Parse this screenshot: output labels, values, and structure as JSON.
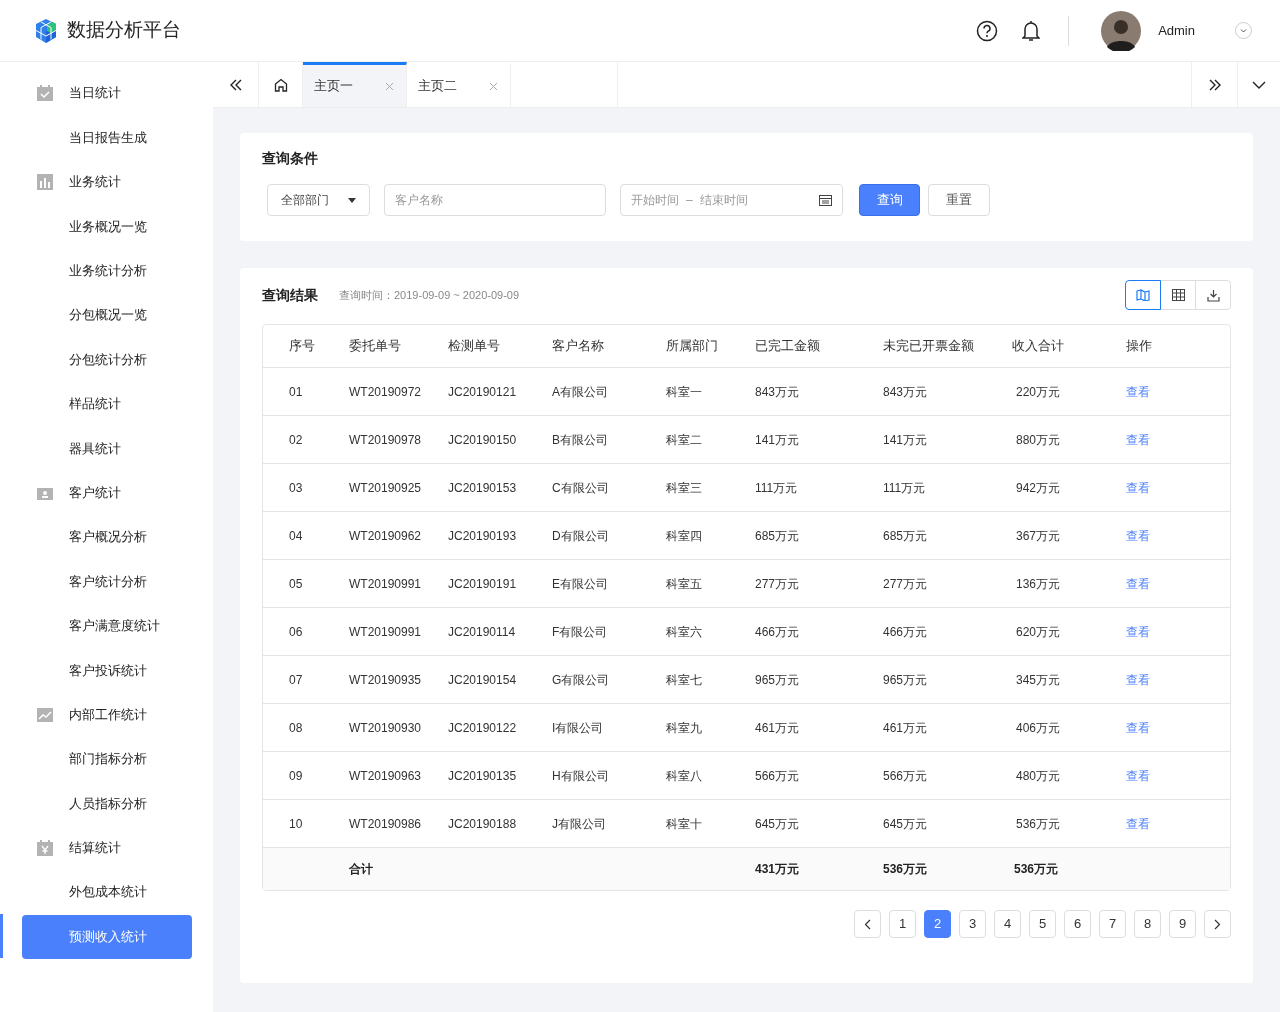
{
  "app": {
    "title": "数据分析平台"
  },
  "header": {
    "user": "Admin"
  },
  "sidebar": {
    "items": [
      {
        "kind": "group",
        "label": "当日统计",
        "selected": false
      },
      {
        "kind": "item",
        "label": "当日报告生成",
        "selected": false
      },
      {
        "kind": "group",
        "label": "业务统计",
        "selected": false
      },
      {
        "kind": "item",
        "label": "业务概况一览",
        "selected": false
      },
      {
        "kind": "item",
        "label": "业务统计分析",
        "selected": false
      },
      {
        "kind": "item",
        "label": "分包概况一览",
        "selected": false
      },
      {
        "kind": "item",
        "label": "分包统计分析",
        "selected": false
      },
      {
        "kind": "item",
        "label": "样品统计",
        "selected": false
      },
      {
        "kind": "item",
        "label": "器具统计",
        "selected": false
      },
      {
        "kind": "group",
        "label": "客户统计",
        "selected": false
      },
      {
        "kind": "item",
        "label": "客户概况分析",
        "selected": false
      },
      {
        "kind": "item",
        "label": "客户统计分析",
        "selected": false
      },
      {
        "kind": "item",
        "label": "客户满意度统计",
        "selected": false
      },
      {
        "kind": "item",
        "label": "客户投诉统计",
        "selected": false
      },
      {
        "kind": "group",
        "label": "内部工作统计",
        "selected": false
      },
      {
        "kind": "item",
        "label": "部门指标分析",
        "selected": false
      },
      {
        "kind": "item",
        "label": "人员指标分析",
        "selected": false
      },
      {
        "kind": "group",
        "label": "结算统计",
        "selected": false
      },
      {
        "kind": "item",
        "label": "外包成本统计",
        "selected": false
      },
      {
        "kind": "item",
        "label": "预测收入统计",
        "selected": true
      }
    ]
  },
  "tabs": [
    {
      "label": "主页一",
      "selected": true
    },
    {
      "label": "主页二",
      "selected": false
    }
  ],
  "query": {
    "title": "查询条件",
    "department": "全部部门",
    "customer_placeholder": "客户名称",
    "start_placeholder": "开始时间",
    "separator": "–",
    "end_placeholder": "结束时间",
    "search_button": "查询",
    "reset_button": "重置"
  },
  "results": {
    "title": "查询结果",
    "subtitle": "查询时间：2019-09-09 ~ 2020-09-09",
    "views": [
      {
        "selected": true
      },
      {
        "selected": false
      },
      {
        "selected": false
      }
    ],
    "table": {
      "columns": [
        "序号",
        "委托单号",
        "检测单号",
        "客户名称",
        "所属部门",
        "已完工金额",
        "未完已开票金额",
        "收入合计",
        "操作"
      ],
      "rows": [
        [
          "01",
          "WT20190972",
          "JC20190121",
          "A有限公司",
          "科室一",
          "843万元",
          "843万元",
          "220万元",
          "查看"
        ],
        [
          "02",
          "WT20190978",
          "JC20190150",
          "B有限公司",
          "科室二",
          "141万元",
          "141万元",
          "880万元",
          "查看"
        ],
        [
          "03",
          "WT20190925",
          "JC20190153",
          "C有限公司",
          "科室三",
          "111万元",
          "111万元",
          "942万元",
          "查看"
        ],
        [
          "04",
          "WT20190962",
          "JC20190193",
          "D有限公司",
          "科室四",
          "685万元",
          "685万元",
          "367万元",
          "查看"
        ],
        [
          "05",
          "WT20190991",
          "JC20190191",
          "E有限公司",
          "科室五",
          "277万元",
          "277万元",
          "136万元",
          "查看"
        ],
        [
          "06",
          "WT20190991",
          "JC20190114",
          "F有限公司",
          "科室六",
          "466万元",
          "466万元",
          "620万元",
          "查看"
        ],
        [
          "07",
          "WT20190935",
          "JC20190154",
          "G有限公司",
          "科室七",
          "965万元",
          "965万元",
          "345万元",
          "查看"
        ],
        [
          "08",
          "WT20190930",
          "JC20190122",
          "I有限公司",
          "科室九",
          "461万元",
          "461万元",
          "406万元",
          "查看"
        ],
        [
          "09",
          "WT20190963",
          "JC20190135",
          "H有限公司",
          "科室八",
          "566万元",
          "566万元",
          "480万元",
          "查看"
        ],
        [
          "10",
          "WT20190986",
          "JC20190188",
          "J有限公司",
          "科室十",
          "645万元",
          "645万元",
          "536万元",
          "查看"
        ]
      ],
      "total": {
        "label": "合计",
        "completed": "431万元",
        "invoiced": "536万元",
        "income": "536万元"
      }
    },
    "pagination": {
      "pages": [
        {
          "label": "1",
          "selected": false
        },
        {
          "label": "2",
          "selected": true
        },
        {
          "label": "3",
          "selected": false
        },
        {
          "label": "4",
          "selected": false
        },
        {
          "label": "5",
          "selected": false
        },
        {
          "label": "6",
          "selected": false
        },
        {
          "label": "7",
          "selected": false
        },
        {
          "label": "8",
          "selected": false
        },
        {
          "label": "9",
          "selected": false
        }
      ]
    }
  }
}
